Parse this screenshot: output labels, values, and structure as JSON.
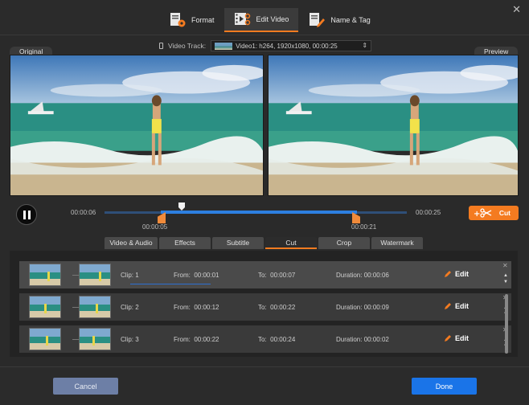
{
  "window": {
    "close_icon": "close-icon"
  },
  "tabs": [
    {
      "label": "Format",
      "icon": "format-icon"
    },
    {
      "label": "Edit Video",
      "icon": "edit-video-icon"
    },
    {
      "label": "Name & Tag",
      "icon": "name-tag-icon"
    }
  ],
  "video_track": {
    "label": "Video Track:",
    "value": "Video1: h264, 1920x1080, 00:00:25"
  },
  "panels": {
    "original": "Original",
    "preview": "Preview"
  },
  "player": {
    "current_time": "00:00:06",
    "total_time": "00:00:25",
    "start_marker": "00:00:05",
    "end_marker": "00:00:21",
    "cut_label": "Cut"
  },
  "edit_tabs": [
    "Video & Audio",
    "Effects",
    "Subtitle",
    "Cut",
    "Crop",
    "Watermark"
  ],
  "clips": [
    {
      "clip_label": "Clip:",
      "clip_no": "1",
      "from_label": "From:",
      "from": "00:00:01",
      "to_label": "To:",
      "to": "00:00:07",
      "dur_label": "Duration:",
      "duration": "00:00:06",
      "edit_label": "Edit"
    },
    {
      "clip_label": "Clip:",
      "clip_no": "2",
      "from_label": "From:",
      "from": "00:00:12",
      "to_label": "To:",
      "to": "00:00:22",
      "dur_label": "Duration:",
      "duration": "00:00:09",
      "edit_label": "Edit"
    },
    {
      "clip_label": "Clip:",
      "clip_no": "3",
      "from_label": "From:",
      "from": "00:00:22",
      "to_label": "To:",
      "to": "00:00:24",
      "dur_label": "Duration:",
      "duration": "00:00:02",
      "edit_label": "Edit"
    }
  ],
  "footer": {
    "cancel": "Cancel",
    "done": "Done"
  },
  "colors": {
    "accent": "#f47b20",
    "primary": "#1a74e8",
    "cancel": "#6d7fa6"
  }
}
